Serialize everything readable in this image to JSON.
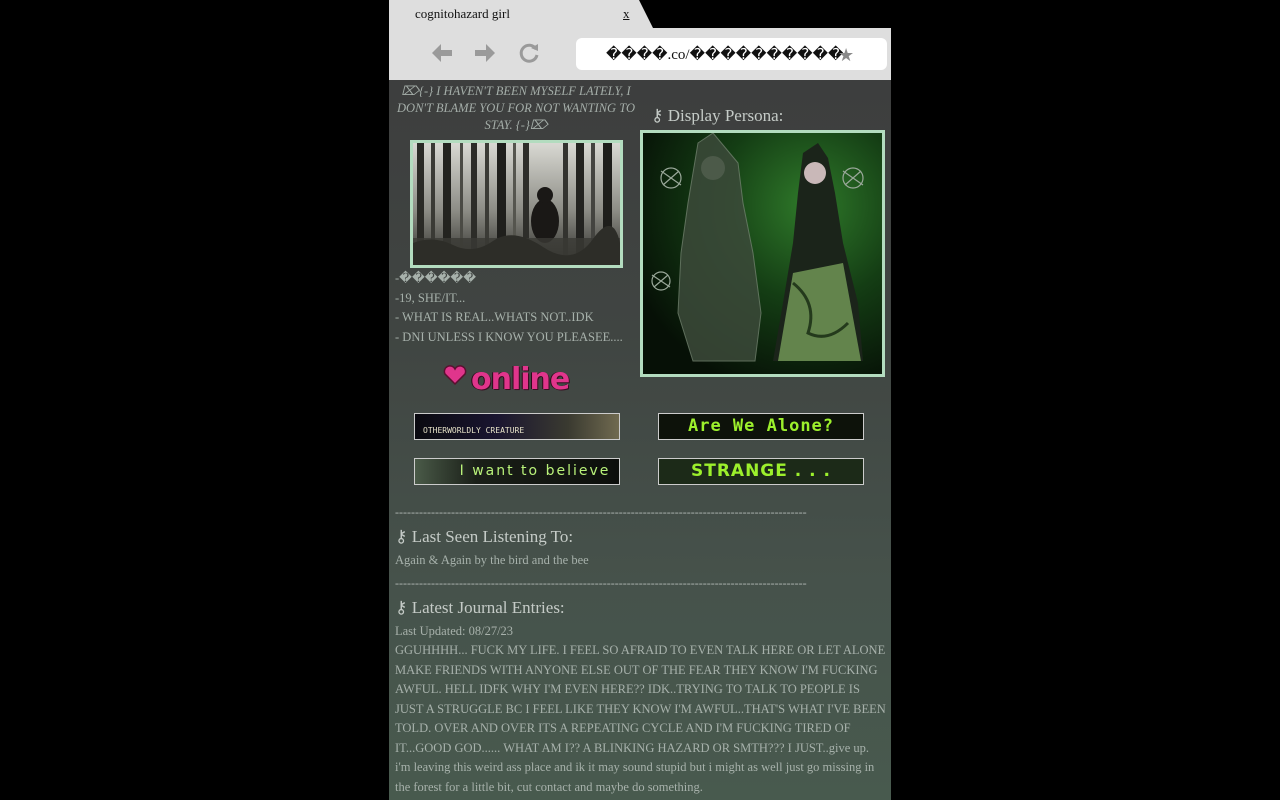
{
  "browser": {
    "tab_title": "cognitohazard girl",
    "tab_close": "x",
    "url": "����.co/����������",
    "tab_color": "#dedede",
    "toolbar_color": "#dedede"
  },
  "profile": {
    "quote": "⌦{-} I HAVEN'T BEEN MYSELF LATELY, I DON'T BLAME YOU FOR NOT WANTING TO STAY. {-}⌦",
    "bio": [
      "-������",
      "-19, SHE/IT...",
      "- WHAT IS REAL..WHATS NOT..IDK",
      "- DNI UNLESS I KNOW YOU PLEASEE...."
    ],
    "online_label": "online",
    "badges": {
      "otherworldly": "OTHERWORLDLY CREATURE",
      "alone": "Are We Alone?",
      "believe": "I want to believe",
      "strange": "STRANGE . . ."
    },
    "persona_heading": "⚷ Display Persona:",
    "divider": "-------------------------------------------------------------------------------------------------------",
    "listening": {
      "heading": "⚷ Last Seen Listening To:",
      "track": "Again & Again by the bird and the bee"
    },
    "journal": {
      "heading": "⚷ Latest Journal Entries:",
      "updated": "Last Updated: 08/27/23",
      "entry": "GGUHHHH... FUCK MY LIFE. I FEEL SO AFRAID TO EVEN TALK HERE OR LET ALONE MAKE FRIENDS WITH ANYONE ELSE OUT OF THE FEAR THEY KNOW I'M FUCKING AWFUL. HELL IDFK WHY I'M EVEN HERE?? IDK..TRYING TO TALK TO PEOPLE IS JUST A STRUGGLE BC I FEEL LIKE THEY KNOW I'M AWFUL..THAT'S WHAT I'VE BEEN TOLD. OVER AND OVER ITS A REPEATING CYCLE AND I'M FUCKING TIRED OF IT...GOOD GOD...... WHAT AM I?? A BLINKING HAZARD OR SMTH??? I JUST..give up. i'm leaving this weird ass place and ik it may sound stupid but i might as well just go missing in the forest for a little bit, cut contact and maybe do something."
    }
  },
  "colors": {
    "accent_border": "#b3dcbf",
    "online_pink": "#e0358c",
    "alien_green": "#9cf02c"
  },
  "icons": [
    "back-arrow-icon",
    "forward-arrow-icon",
    "reload-icon",
    "star-icon",
    "heart-icon",
    "key-icon"
  ]
}
